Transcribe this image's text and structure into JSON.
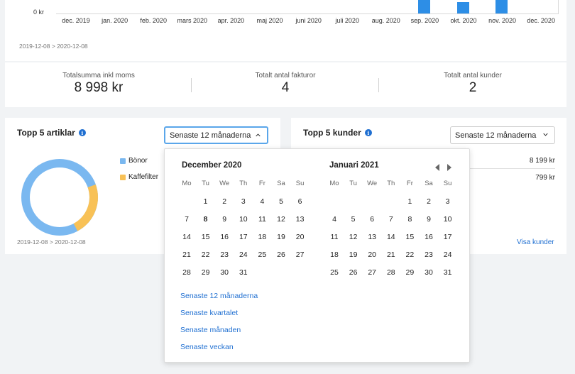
{
  "revenue_chart": {
    "zero_label": "0 kr",
    "months": [
      "dec. 2019",
      "jan. 2020",
      "feb. 2020",
      "mars 2020",
      "apr. 2020",
      "maj 2020",
      "juni 2020",
      "juli 2020",
      "aug. 2020",
      "sep. 2020",
      "okt. 2020",
      "nov. 2020",
      "dec. 2020"
    ],
    "bar_color": "#2d8ee6",
    "date_range": "2019-12-08 > 2020-12-08"
  },
  "summary": {
    "total_label": "Totalsumma inkl moms",
    "total_value": "8 998 kr",
    "invoices_label": "Totalt antal fakturor",
    "invoices_value": "4",
    "customers_label": "Totalt antal kunder",
    "customers_value": "2"
  },
  "top_articles": {
    "title": "Topp 5 artiklar",
    "select_value": "Senaste 12 månaderna",
    "date_range": "2019-12-08 > 2020-12-08",
    "legend": [
      {
        "label": "Bönor",
        "color": "#7ab8f0"
      },
      {
        "label": "Kaffefilter",
        "color": "#f8c156"
      }
    ]
  },
  "top_customers": {
    "title": "Topp 5 kunder",
    "select_value": "Senaste 12 månaderna",
    "rows": [
      {
        "value": "8 199 kr"
      },
      {
        "value": "799 kr"
      }
    ],
    "show_link": "Visa kunder"
  },
  "datepicker": {
    "left_title": "December 2020",
    "right_title": "Januari 2021",
    "weekdays": [
      "Mo",
      "Tu",
      "We",
      "Th",
      "Fr",
      "Sa",
      "Su"
    ],
    "left_weeks": [
      [
        "",
        "1",
        "2",
        "3",
        "4",
        "5",
        "6"
      ],
      [
        "7",
        "8",
        "9",
        "10",
        "11",
        "12",
        "13"
      ],
      [
        "14",
        "15",
        "16",
        "17",
        "18",
        "19",
        "20"
      ],
      [
        "21",
        "22",
        "23",
        "24",
        "25",
        "26",
        "27"
      ],
      [
        "28",
        "29",
        "30",
        "31",
        "",
        "",
        ""
      ]
    ],
    "right_weeks": [
      [
        "",
        "",
        "",
        "",
        "1",
        "2",
        "3"
      ],
      [
        "4",
        "5",
        "6",
        "7",
        "8",
        "9",
        "10"
      ],
      [
        "11",
        "12",
        "13",
        "14",
        "15",
        "16",
        "17"
      ],
      [
        "18",
        "19",
        "20",
        "21",
        "22",
        "23",
        "24"
      ],
      [
        "25",
        "26",
        "27",
        "28",
        "29",
        "30",
        "31"
      ]
    ],
    "highlighted_day": "8",
    "presets": [
      "Senaste 12 månaderna",
      "Senaste kvartalet",
      "Senaste månaden",
      "Senaste veckan"
    ]
  }
}
